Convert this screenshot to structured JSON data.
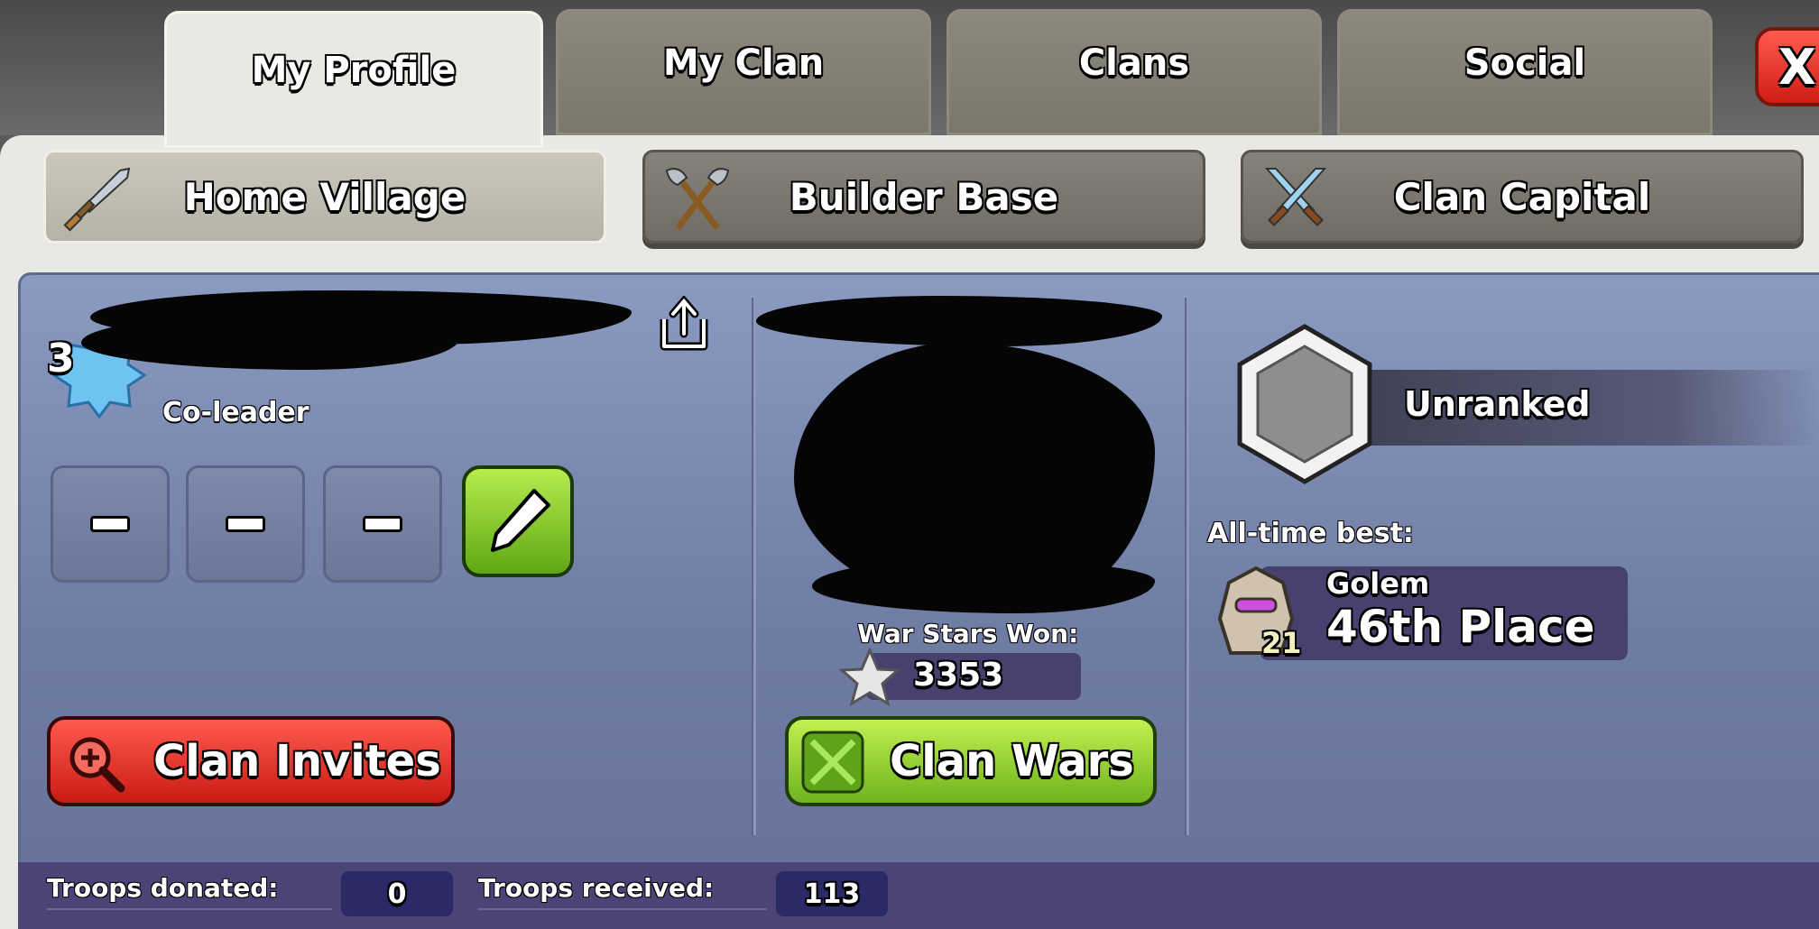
{
  "tabs": [
    {
      "label": "My Profile",
      "active": true
    },
    {
      "label": "My Clan",
      "active": false
    },
    {
      "label": "Clans",
      "active": false
    },
    {
      "label": "Social",
      "active": false
    }
  ],
  "close_label": "X",
  "subtabs": [
    {
      "label": "Home Village",
      "icon": "sword-icon",
      "active": true
    },
    {
      "label": "Builder Base",
      "icon": "crossed-axes-icon",
      "active": false
    },
    {
      "label": "Clan Capital",
      "icon": "crossed-swords-icon",
      "active": false
    }
  ],
  "profile": {
    "level": "3",
    "role": "Co-leader",
    "slots": [
      "-",
      "-",
      "-"
    ]
  },
  "war": {
    "stars_label": "War Stars Won:",
    "stars_value": "3353"
  },
  "league": {
    "current": "Unranked",
    "best_label": "All-time best:",
    "best_league": "Golem",
    "best_place": "46th Place",
    "best_badge_level": "21"
  },
  "buttons": {
    "clan_invites": "Clan Invites",
    "clan_wars": "Clan Wars"
  },
  "stats": {
    "donated_label": "Troops donated:",
    "donated_value": "0",
    "received_label": "Troops received:",
    "received_value": "113"
  },
  "colors": {
    "card_bg": "#7a87ad",
    "accent_red": "#e0342b",
    "accent_green": "#8fd13a",
    "bar_bg": "#4b4577"
  }
}
